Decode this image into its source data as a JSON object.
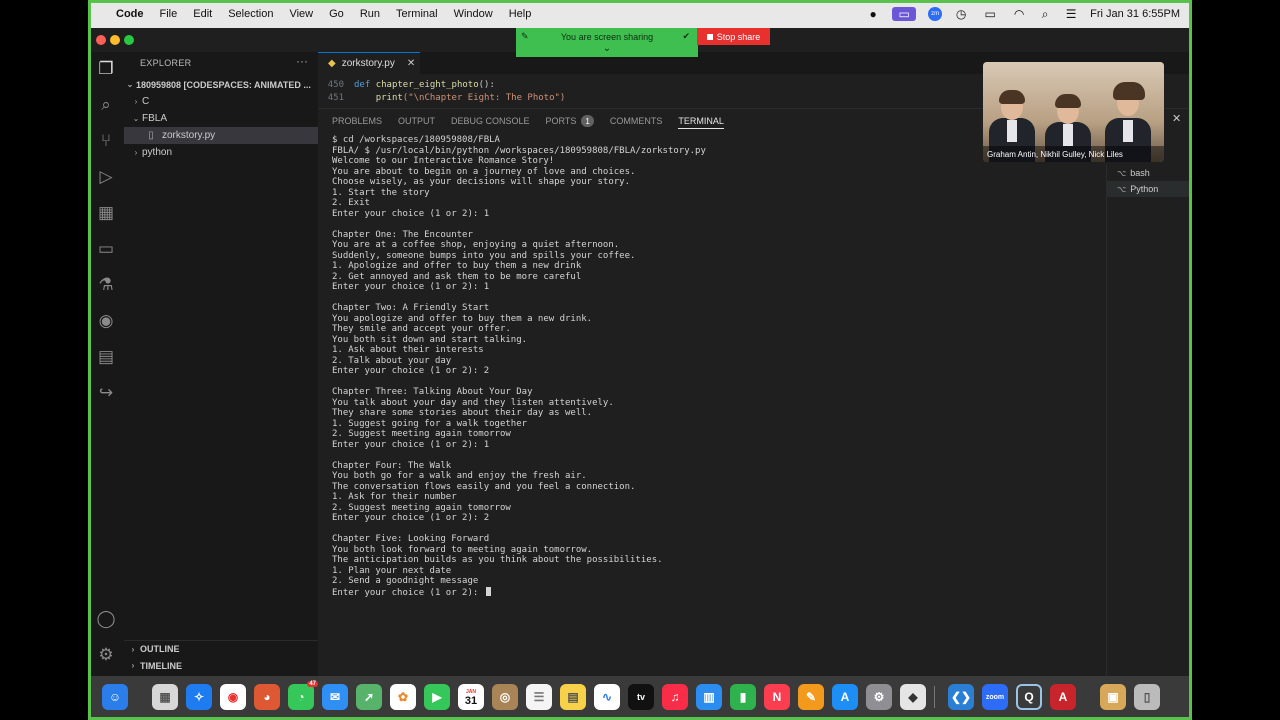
{
  "menubar": {
    "apple_icon": "apple-icon",
    "app_name": "Code",
    "menus": [
      "File",
      "Edit",
      "Selection",
      "View",
      "Go",
      "Run",
      "Terminal",
      "Window",
      "Help"
    ],
    "clock": "Fri Jan 31  6:55PM",
    "zoom_icon": "zm"
  },
  "share_banner": {
    "status_text": "You are screen sharing",
    "stop_label": "Stop share"
  },
  "sidebar": {
    "title": "EXPLORER",
    "root": "180959808 [CODESPACES: ANIMATED ...",
    "items": [
      {
        "label": "C",
        "type": "folder"
      },
      {
        "label": "FBLA",
        "type": "folder"
      },
      {
        "label": "zorkstory.py",
        "type": "file"
      },
      {
        "label": "python",
        "type": "folder"
      }
    ],
    "outline": "OUTLINE",
    "timeline": "TIMELINE"
  },
  "editor": {
    "tab_label": "zorkstory.py",
    "lines": [
      {
        "num": "450",
        "kw": "def ",
        "fn": "chapter_eight_photo",
        "rest": "():"
      },
      {
        "num": "451",
        "indent": "    ",
        "fn": "print",
        "str": "(\"\\nChapter Eight: The Photo\")"
      }
    ]
  },
  "panel": {
    "tabs": [
      "PROBLEMS",
      "OUTPUT",
      "DEBUG CONSOLE",
      "PORTS",
      "COMMENTS",
      "TERMINAL"
    ],
    "ports_badge": "1",
    "terminals": [
      "bash",
      "Python"
    ]
  },
  "terminal_lines": [
    "$ cd /workspaces/180959808/FBLA",
    "FBLA/ $ /usr/local/bin/python /workspaces/180959808/FBLA/zorkstory.py",
    "Welcome to our Interactive Romance Story!",
    "You are about to begin on a journey of love and choices.",
    "Choose wisely, as your decisions will shape your story.",
    "1. Start the story",
    "2. Exit",
    "Enter your choice (1 or 2): 1",
    "",
    "Chapter One: The Encounter",
    "You are at a coffee shop, enjoying a quiet afternoon.",
    "Suddenly, someone bumps into you and spills your coffee.",
    "1. Apologize and offer to buy them a new drink",
    "2. Get annoyed and ask them to be more careful",
    "Enter your choice (1 or 2): 1",
    "",
    "Chapter Two: A Friendly Start",
    "You apologize and offer to buy them a new drink.",
    "They smile and accept your offer.",
    "You both sit down and start talking.",
    "1. Ask about their interests",
    "2. Talk about your day",
    "Enter your choice (1 or 2): 2",
    "",
    "Chapter Three: Talking About Your Day",
    "You talk about your day and they listen attentively.",
    "They share some stories about their day as well.",
    "1. Suggest going for a walk together",
    "2. Suggest meeting again tomorrow",
    "Enter your choice (1 or 2): 1",
    "",
    "Chapter Four: The Walk",
    "You both go for a walk and enjoy the fresh air.",
    "The conversation flows easily and you feel a connection.",
    "1. Ask for their number",
    "2. Suggest meeting again tomorrow",
    "Enter your choice (1 or 2): 2",
    "",
    "Chapter Five: Looking Forward",
    "You both look forward to meeting again tomorrow.",
    "The anticipation builds as you think about the possibilities.",
    "1. Plan your next date",
    "2. Send a goodnight message",
    "Enter your choice (1 or 2): "
  ],
  "video": {
    "names": "Graham Antin, Nikhil Gulley, Nick Liles"
  },
  "dock": {
    "calendar_month": "JAN",
    "calendar_day": "31",
    "messages_badge": "47",
    "apps": [
      "finder",
      "launchpad",
      "safari",
      "chrome",
      "duckduckgo",
      "messages",
      "mail",
      "maps",
      "photos",
      "facetime",
      "calendar",
      "notes-app",
      "reminders",
      "notes",
      "freeform",
      "tv",
      "music",
      "keynote",
      "numbers",
      "news",
      "pages",
      "app-store",
      "system-settings",
      "roblox",
      "vscode",
      "zoom",
      "quicktime",
      "acrobat",
      "archive",
      "trash"
    ],
    "tv_label": "tv",
    "zoom_label": "zoom"
  }
}
